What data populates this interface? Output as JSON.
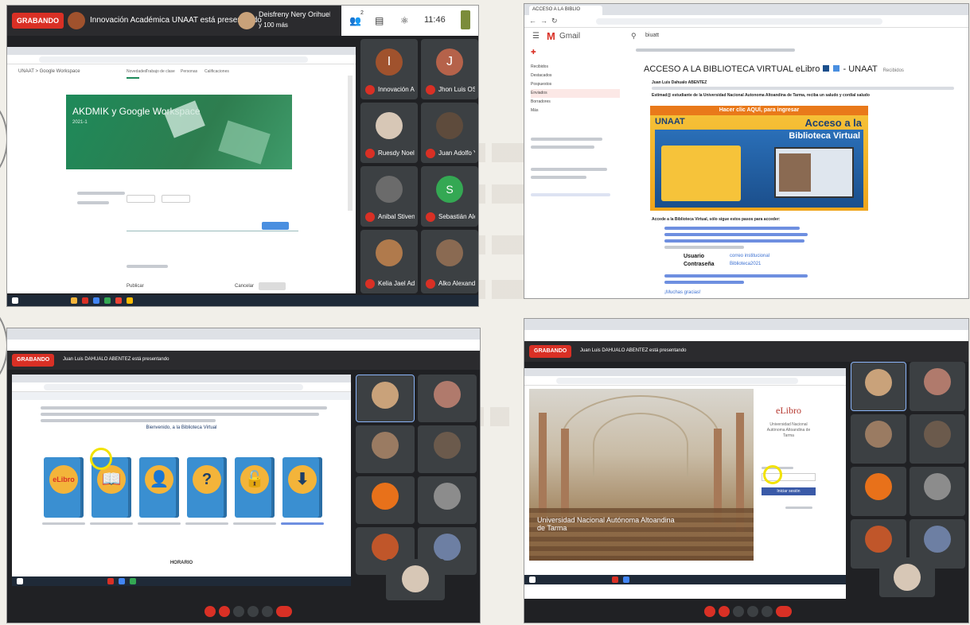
{
  "meet": {
    "recording_label": "GRABANDO",
    "presenter_text": "Innovación Académica UNAAT está presentando",
    "user_name": "Deisfreny Nery Orihuela Cb...",
    "user_sub": "y 100 más",
    "clock": "11:46",
    "participant_count": "2"
  },
  "panel1": {
    "doc_title": "UNAAT > Google Workspace",
    "tabs": [
      "Novedades",
      "Trabajo de clase",
      "Personas",
      "Calificaciones"
    ],
    "banner_title": "AKDMIK y Google Workspace",
    "banner_sub": "2021-1",
    "buttons": [
      "Publicar",
      "Cancelar"
    ],
    "participants": [
      "Innovación Acad...",
      "Jhon Luis OSN...",
      "Ruesdy Noeliday...",
      "Juan Adolfo Yuc...",
      "Anibal Stiven Yh...",
      "Sebastián Alexand...",
      "Kelia Jael Adoll...",
      "Alko Alexandr B..."
    ],
    "tile_initials": [
      "I",
      "J",
      "S"
    ]
  },
  "panel2": {
    "tab_title": "ACCESO A LA BIBLIO",
    "app_name": "Gmail",
    "search_text": "biuatt",
    "subject": "ACCESO A LA BIBLIOTECA VIRTUAL eLibro",
    "subject_tail": "- UNAAT",
    "inbox_label": "Recibidos",
    "sender": "Juan Luis Dahualo ABENTEZ",
    "greeting": "Estimad@ estudiante de la Universidad Nacional Autonoma Altoandina de Tarma, reciba un saludo y cordial saludo",
    "flyer_cta": "Hacer clic AQUÍ, para ingresar",
    "flyer_logo": "UNAAT",
    "flyer_title_1": "Acceso a la",
    "flyer_title_2": "Biblioteca Virtual",
    "access_heading": "Accede a la Biblioteca Virtual, sólo sigue estos pasos para acceder:",
    "user_label": "Usuario",
    "user_value": "correo institucional",
    "password_label": "Contraseña",
    "password_value": "Biblioteca2021",
    "closing": "¡Muchas gracias!",
    "sidebar_items": [
      "Recibidos",
      "Destacados",
      "Pospuestos",
      "Enviados",
      "Borradores",
      "Más"
    ]
  },
  "panel3": {
    "recording_label": "GRABANDO",
    "presenter_text": "Juan Luis DAHUALO ABENTEZ está presentando",
    "intro_text": "Bienvenido, a la Biblioteca Virtual",
    "book_glyphs": [
      "eLibro",
      "📖",
      "👤",
      "?",
      "🔓",
      "⬇"
    ],
    "bottom_label": "HORARIO"
  },
  "panel4": {
    "recording_label": "GRABANDO",
    "presenter_text": "Juan Luis DAHUALO ABENTEZ está presentando",
    "brand": "eLibro",
    "university": "Universidad Nacional Autónoma Altoandina de Tarma",
    "hall_caption": "Universidad Nacional Autónoma Altoandina de Tarma",
    "login_button": "Iniciar sesión"
  },
  "colors": {
    "recording": "#d93025",
    "meet_dark": "#202124",
    "classroom_green": "#1e8a5a",
    "flyer_orange": "#f0a51b",
    "book_blue": "#3a8fd1",
    "highlight": "#f2e200"
  }
}
